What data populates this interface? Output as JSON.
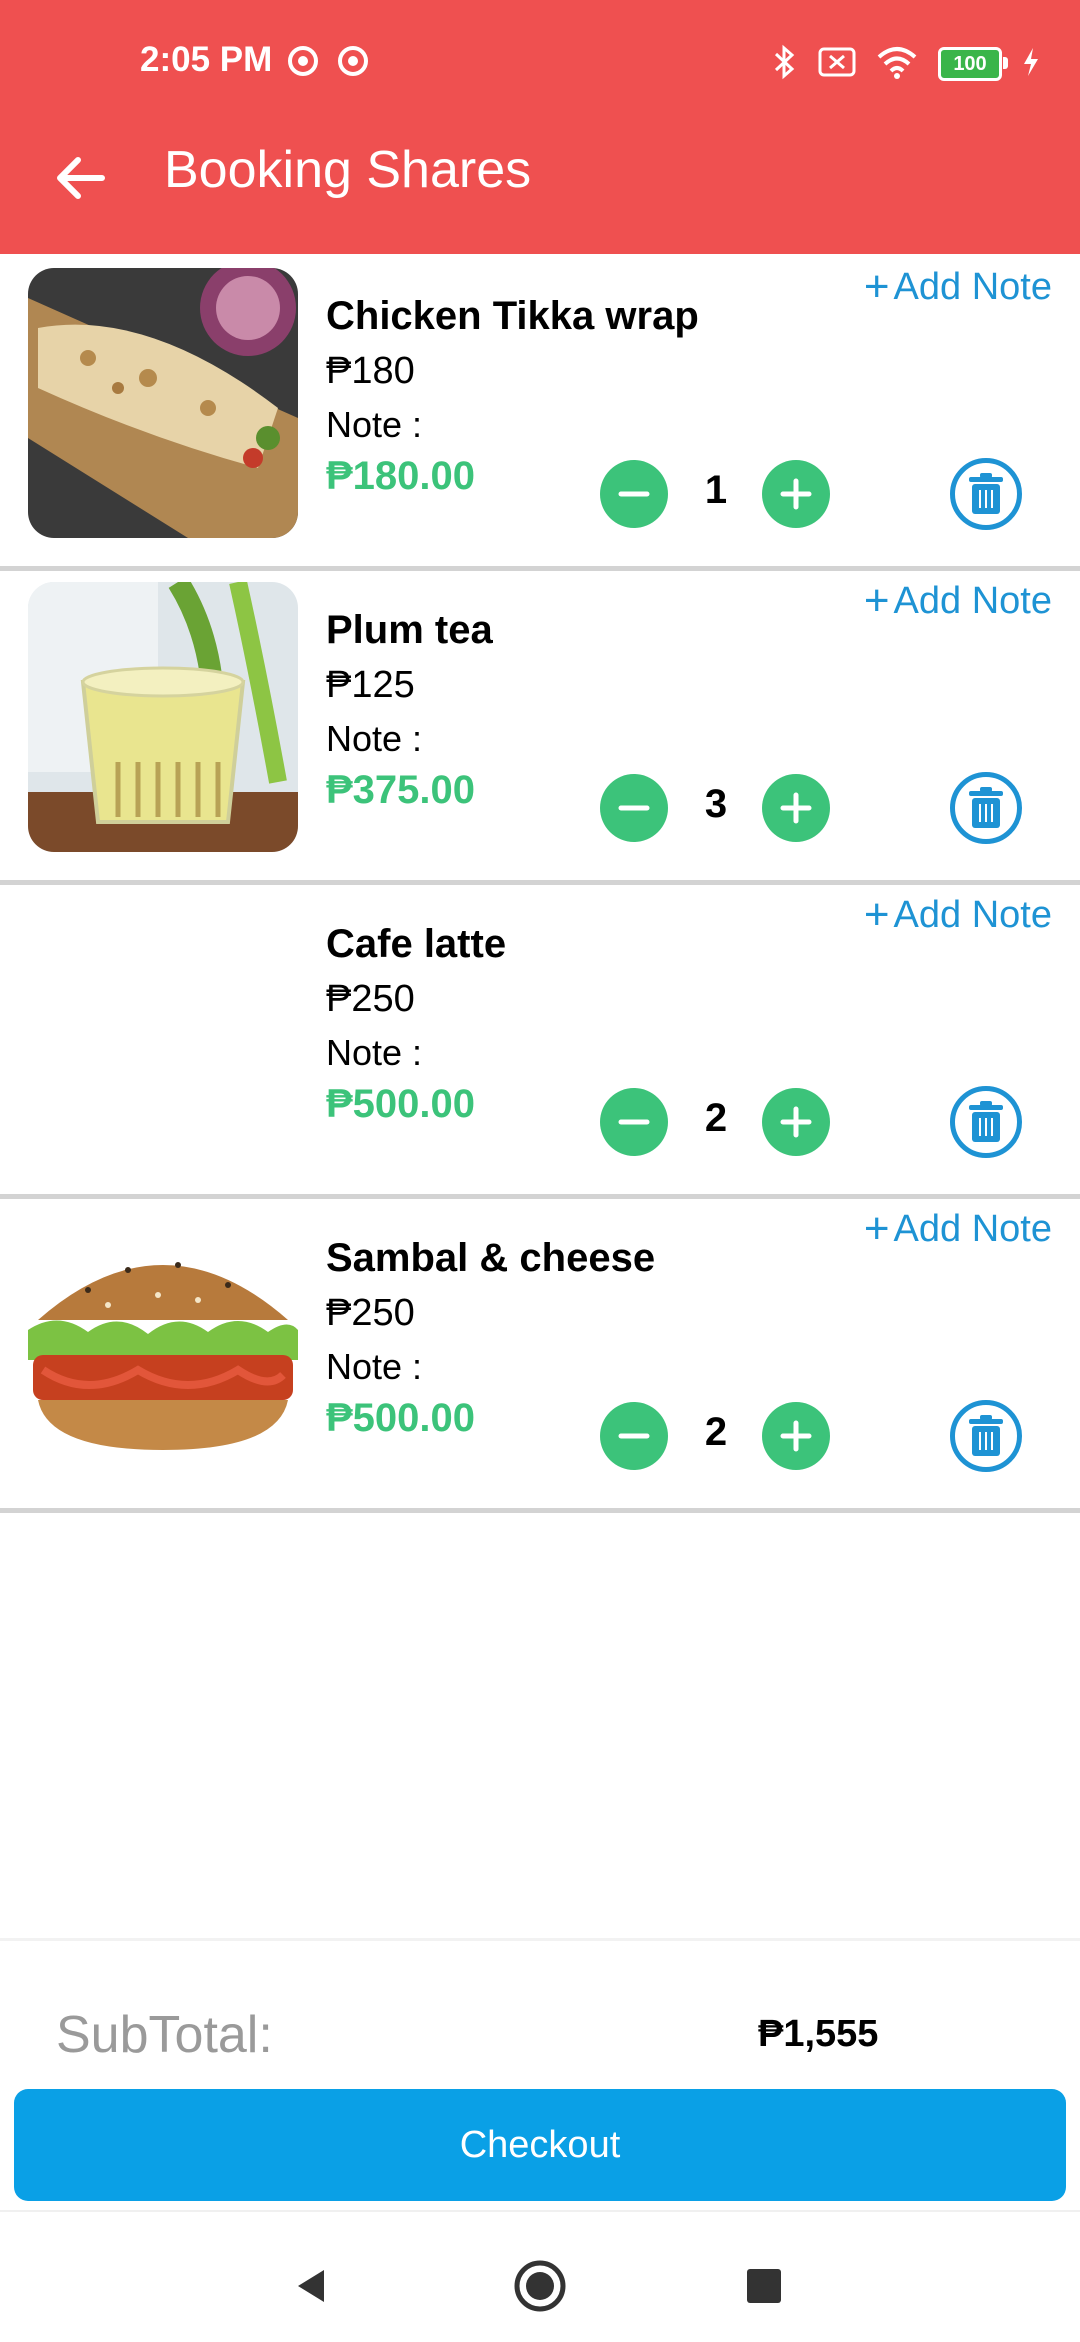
{
  "status_bar": {
    "time": "2:05 PM",
    "battery": "100"
  },
  "header": {
    "title": "Booking Shares"
  },
  "items": [
    {
      "name": "Chicken Tikka wrap",
      "price": "₱180",
      "note_label": "Note :",
      "total": "₱180.00",
      "quantity": "1",
      "add_note_label": "Add Note",
      "image": "wrap"
    },
    {
      "name": "Plum tea",
      "price": "₱125",
      "note_label": "Note :",
      "total": "₱375.00",
      "quantity": "3",
      "add_note_label": "Add Note",
      "image": "tea"
    },
    {
      "name": "Cafe latte",
      "price": "₱250",
      "note_label": "Note :",
      "total": "₱500.00",
      "quantity": "2",
      "add_note_label": "Add Note",
      "image": "none"
    },
    {
      "name": "Sambal & cheese",
      "price": "₱250",
      "note_label": "Note :",
      "total": "₱500.00",
      "quantity": "2",
      "add_note_label": "Add Note",
      "image": "burger"
    }
  ],
  "footer": {
    "subtotal_label": "SubTotal:",
    "subtotal_value": "₱1,555",
    "checkout_label": "Checkout"
  },
  "colors": {
    "header": "#ef5050",
    "accent_green": "#3cc37a",
    "accent_blue": "#1e93d4",
    "checkout": "#0aa0e6"
  }
}
